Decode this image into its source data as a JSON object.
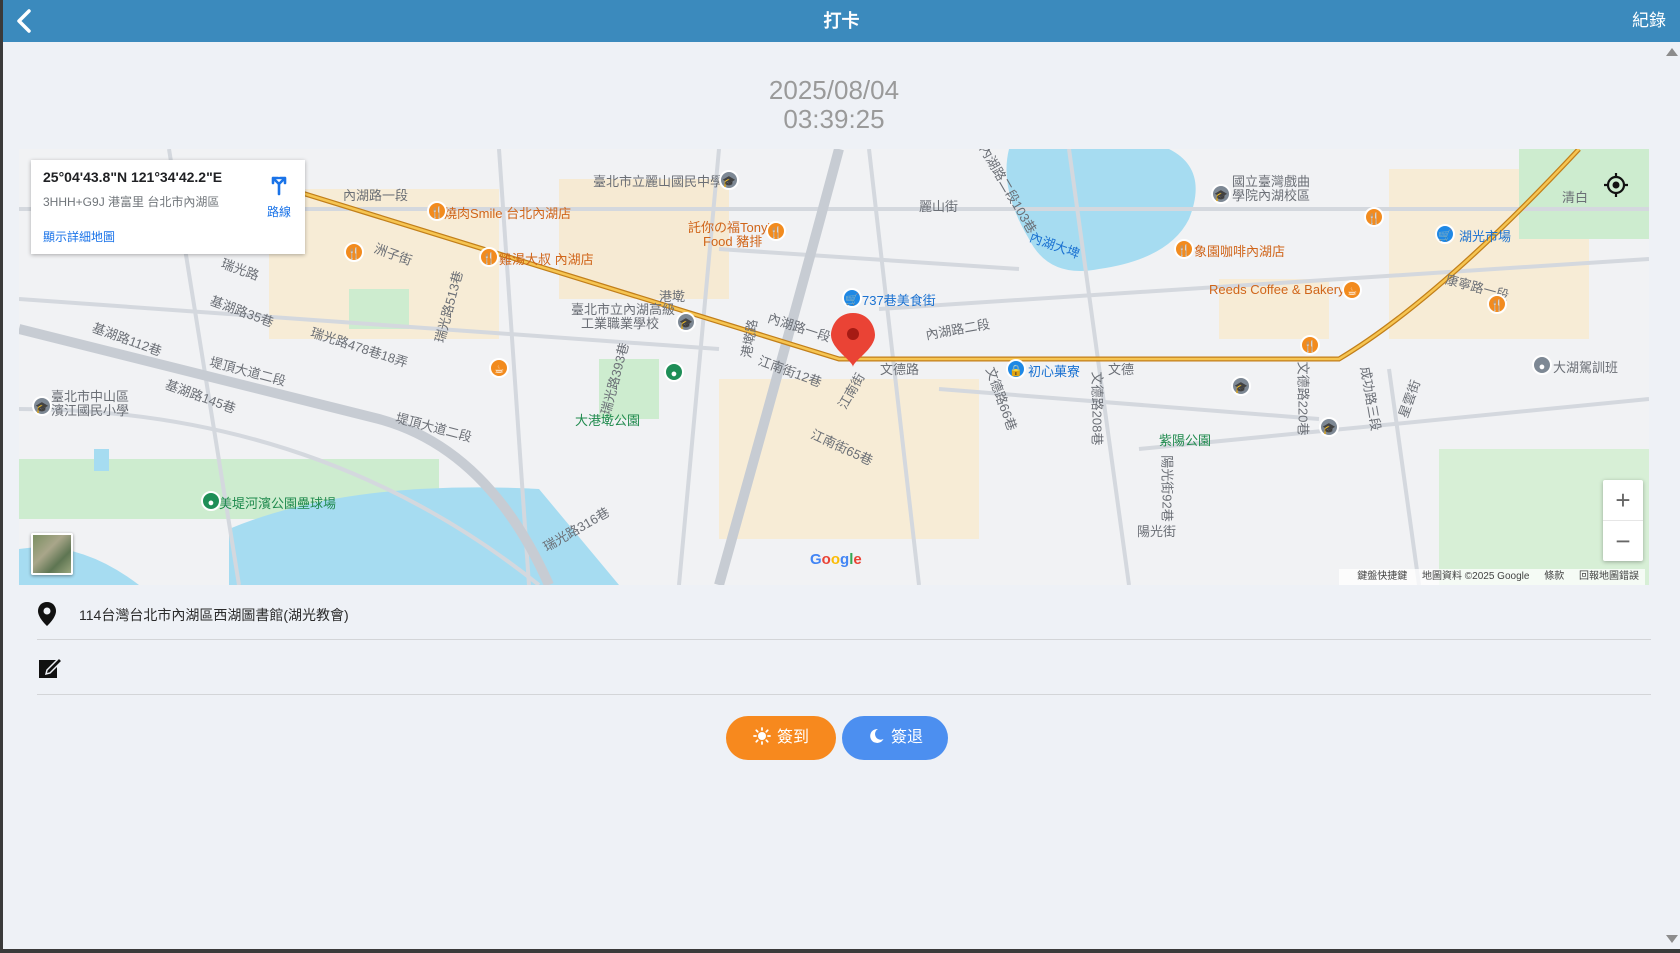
{
  "header": {
    "title": "打卡",
    "record_label": "紀錄",
    "back_icon": "chevron-left-icon"
  },
  "datetime": {
    "date": "2025/08/04",
    "time": "03:39:25"
  },
  "map": {
    "info_card": {
      "coordinates": "25°04'43.8\"N 121°34'42.2\"E",
      "plus_code": "3HHH+G9J 港富里 台北市內湖區",
      "route_label": "路線",
      "detail_link": "顯示詳細地圖"
    },
    "labels": {
      "neihu_rd1_top": "內湖路一段",
      "school_lishan": "臺北市立麗山國民中學",
      "theater_school": "國立臺灣戲曲",
      "theater_school2": "學院內湖校區",
      "yakiniku": "燒肉Smile 台北內湖店",
      "tony": "託你の福Tony's",
      "tony2": "Food 豬排",
      "chicken": "雞湯大叔 內湖店",
      "elephant_cafe": "象園咖啡內湖店",
      "reeds": "Reeds Coffee & Bakery",
      "lake": "內湖大埤",
      "market": "湖光市場",
      "food737": "737巷美食街",
      "gangqian": "港墘",
      "neihu_vocational": "臺北市立內湖高級",
      "neihu_vocational2": "工業職業學校",
      "neihu_rd1": "內湖路一段",
      "neihu_rd2": "內湖路二段",
      "wende_rd": "文德路",
      "chuxin": "初心菓寮",
      "wende": "文德",
      "dagangqian_park": "大港墘公園",
      "zhongshan_school": "臺北市中山區",
      "zhongshan_school2": "濱江國民小學",
      "meiti_field": "美堤河濱公園壘球場",
      "ziyang_park": "紫陽公園",
      "dahu_training": "大湖駕訓班",
      "qingbai": "清白",
      "zhouzi": "洲子街",
      "ruiguang": "瑞光路",
      "jihu35": "基湖路35巷",
      "jihu112": "基湖路112巷",
      "jihu145": "基湖路145巷",
      "diding2_a": "堤頂大道二段",
      "diding2_b": "堤頂大道二段",
      "ruiguang478": "瑞光路478巷18弄",
      "ruiguang513": "瑞光路513巷",
      "ruiguang393": "瑞光路393巷",
      "ruiguang316": "瑞光路316巷",
      "jiangnan12": "江南街12巷",
      "jiangnan65": "江南街65巷",
      "jiangnan": "江南街",
      "wende66": "文德路66巷",
      "wende208": "文德路208巷",
      "wende220": "文德路220巷",
      "chenggong3": "成功路三段",
      "kangning1": "康寧路一段",
      "yangguang": "陽光街",
      "lishan": "麗山街",
      "neihu2_103": "內湖路二段103巷",
      "gangqian_rd": "港墘路",
      "xinghu": "星雲街",
      "yangguang92": "陽光街92巷"
    },
    "attribution": {
      "shortcuts": "鍵盤快捷鍵",
      "map_data": "地圖資料 ©2025 Google",
      "terms": "條款",
      "report": "回報地圖錯誤"
    },
    "google_logo": "Google"
  },
  "location": {
    "address": "114台灣台北市內湖區西湖圖書館(湖光教會)"
  },
  "actions": {
    "checkin_label": "簽到",
    "checkout_label": "簽退"
  }
}
